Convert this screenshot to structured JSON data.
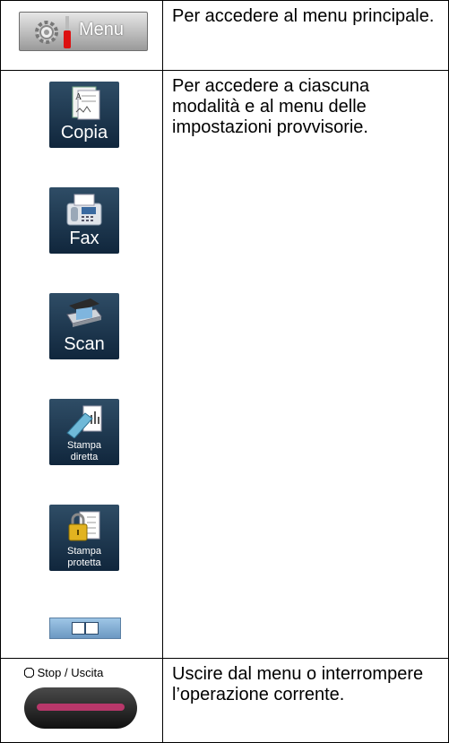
{
  "rows": [
    {
      "button_label": "Menu",
      "description": "Per accedere al menu principale."
    },
    {
      "tiles": [
        {
          "label": "Copia"
        },
        {
          "label": "Fax"
        },
        {
          "label": "Scan"
        },
        {
          "label_line1": "Stampa",
          "label_line2": "diretta"
        },
        {
          "label_line1": "Stampa",
          "label_line2": "protetta"
        }
      ],
      "description": "Per accedere a ciascuna modalità e al menu delle impostazioni provvisorie."
    },
    {
      "stop_label": "Stop / Uscita",
      "description": "Uscire dal menu o interrompere l’operazione corrente."
    }
  ],
  "colors": {
    "tile": "#1e3a52",
    "stop_accent": "#b8376a",
    "book_button": "#8fb8dc"
  },
  "icons": [
    "gear-icon",
    "copy-icon",
    "fax-icon",
    "scanner-icon",
    "usb-direct-print-icon",
    "lock-document-icon",
    "book-icon",
    "stop-symbol-icon"
  ]
}
